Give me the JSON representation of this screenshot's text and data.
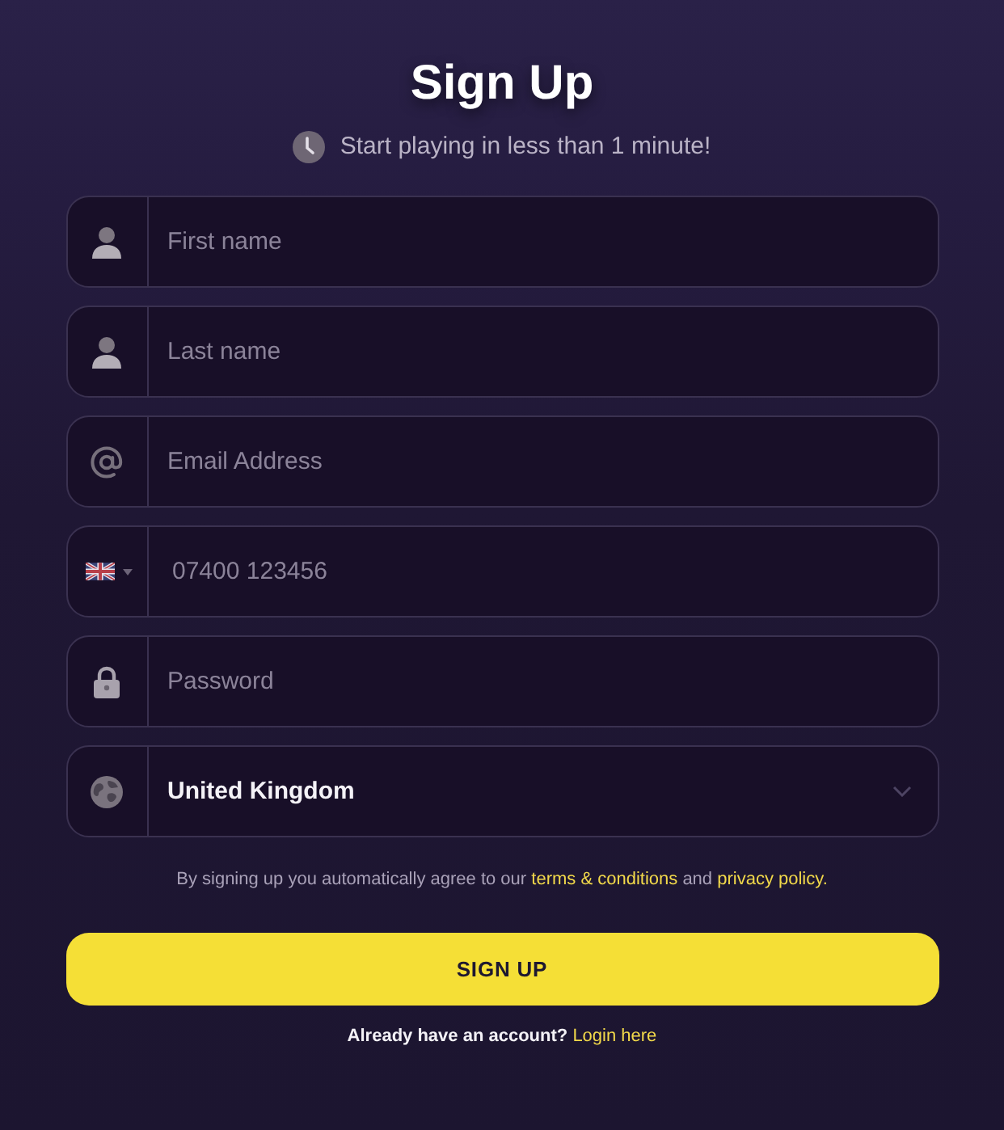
{
  "header": {
    "title": "Sign Up",
    "subtitle": "Start playing in less than 1 minute!"
  },
  "fields": [
    {
      "kind": "first_name",
      "placeholder": "First name"
    },
    {
      "kind": "last_name",
      "placeholder": "Last name"
    },
    {
      "kind": "email",
      "placeholder": "Email Address"
    },
    {
      "kind": "phone",
      "placeholder": "07400 123456"
    },
    {
      "kind": "password",
      "placeholder": "Password"
    },
    {
      "kind": "country",
      "value": "United Kingdom"
    }
  ],
  "terms": [
    {
      "kind": "text",
      "text": "By signing up you automatically agree to our"
    },
    {
      "kind": "link",
      "text": "terms & conditions"
    },
    {
      "kind": "text",
      "text": "and"
    },
    {
      "kind": "link",
      "text": "privacy policy."
    }
  ],
  "submit": {
    "label": "SIGN UP"
  },
  "footer": {
    "prompt": "Already have an account?",
    "link": "Login here"
  }
}
